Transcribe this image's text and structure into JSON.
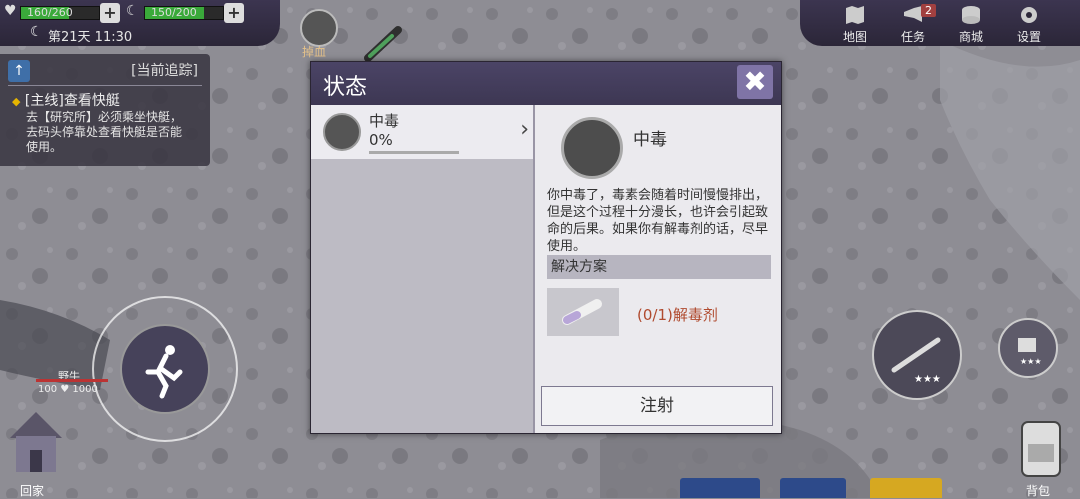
{
  "hud": {
    "health": "160/260",
    "health_fraction": 0.62,
    "stamina": "150/200",
    "stamina_fraction": 0.75,
    "plus": "+",
    "day": "第21天 11:30"
  },
  "tracking": {
    "header": "[当前追踪]",
    "up_icon": "↑",
    "quest_title": "[主线]查看快艇",
    "desc_line1": "去【研究所】必须乘坐快艇，",
    "desc_line2": "去码头停靠处查看快艇是否能",
    "desc_line3": "使用。"
  },
  "map_marker": {
    "label": "掉血"
  },
  "menu": {
    "map": "地图",
    "tasks": "任务",
    "tasks_badge": "2",
    "shop": "商城",
    "settings": "设置"
  },
  "dialog": {
    "title": "状态",
    "close_icon": "✖",
    "status_list": [
      {
        "name": "中毒",
        "percent": "0%",
        "progress": 0.0,
        "chevron": "›"
      }
    ],
    "detail": {
      "name": "中毒",
      "description": "你中毒了，毒素会随着时间慢慢排出，但是这个过程十分漫长，也许会引起致命的后果。如果你有解毒剂的话，尽早使用。",
      "solution_header": "解决方案",
      "solution_item": "(0/1)解毒剂",
      "action_button": "注射"
    }
  },
  "bottom": {
    "enemy_name": "野牛",
    "enemy_stats": "100 ♥ 1000",
    "home": "回家",
    "bag": "背包",
    "stars": "★★★"
  },
  "colors": {
    "panel_dark": "#3d3753",
    "accent_purple": "#7f74a6",
    "health_green": "#3aa93a",
    "solution_red": "#b04a2e"
  }
}
